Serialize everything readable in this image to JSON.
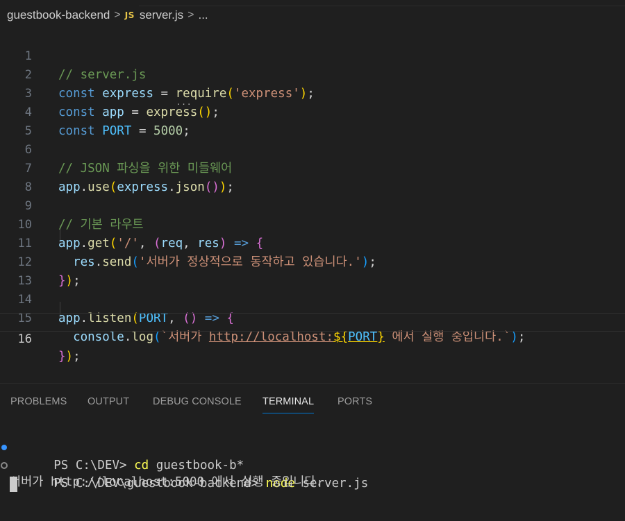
{
  "breadcrumb": {
    "folder": "guestbook-backend",
    "sep": ">",
    "file_icon": "JS",
    "file": "server.js",
    "more": "..."
  },
  "editor": {
    "lines": [
      {
        "n": "1"
      },
      {
        "n": "2"
      },
      {
        "n": "3"
      },
      {
        "n": "4"
      },
      {
        "n": "5"
      },
      {
        "n": "6"
      },
      {
        "n": "7"
      },
      {
        "n": "8"
      },
      {
        "n": "9"
      },
      {
        "n": "10"
      },
      {
        "n": "11"
      },
      {
        "n": "12"
      },
      {
        "n": "13"
      },
      {
        "n": "14"
      },
      {
        "n": "15"
      },
      {
        "n": "16"
      }
    ],
    "tokens": {
      "l1": "// server.js",
      "kw_const": "const",
      "express": "express",
      "eq": "=",
      "require": "require",
      "express_str": "'express'",
      "semi": ";",
      "app": "app",
      "port": "PORT",
      "port_val": "5000",
      "l6": "// JSON 파싱을 위한 미들웨어",
      "use": "use",
      "json": "json",
      "l9": "// 기본 라우트",
      "get": "get",
      "slash_str": "'/'",
      "req": "req",
      "res": "res",
      "arrow": "=>",
      "send": "send",
      "send_str": "'서버가 정상적으로 동작하고 있습니다.'",
      "listen": "listen",
      "console": "console",
      "log": "log",
      "tmpl_a": "`서버가 ",
      "tmpl_url": "http://localhost:",
      "tmpl_b": " 에서 실행 중입니다.`"
    },
    "current_line": "16"
  },
  "panel": {
    "tabs": [
      "PROBLEMS",
      "OUTPUT",
      "DEBUG CONSOLE",
      "TERMINAL",
      "PORTS"
    ],
    "active_tab": "TERMINAL"
  },
  "terminal": {
    "line1_prompt": "PS C:\\DEV> ",
    "line1_cmd": "cd",
    "line1_arg": " guestbook-b*",
    "line2_prompt": "PS C:\\DEV\\guestbook-backend> ",
    "line2_cmd": "node",
    "line2_arg": " server.js",
    "line3": "서버가 http://localhost:5000 에서 실행 중입니다."
  },
  "colors": {
    "background": "#1f1f1f",
    "keyword": "#569cd6",
    "string": "#ce9178",
    "comment": "#6a9955",
    "function": "#dcdcaa",
    "active_tab_underline": "#0078d4"
  }
}
